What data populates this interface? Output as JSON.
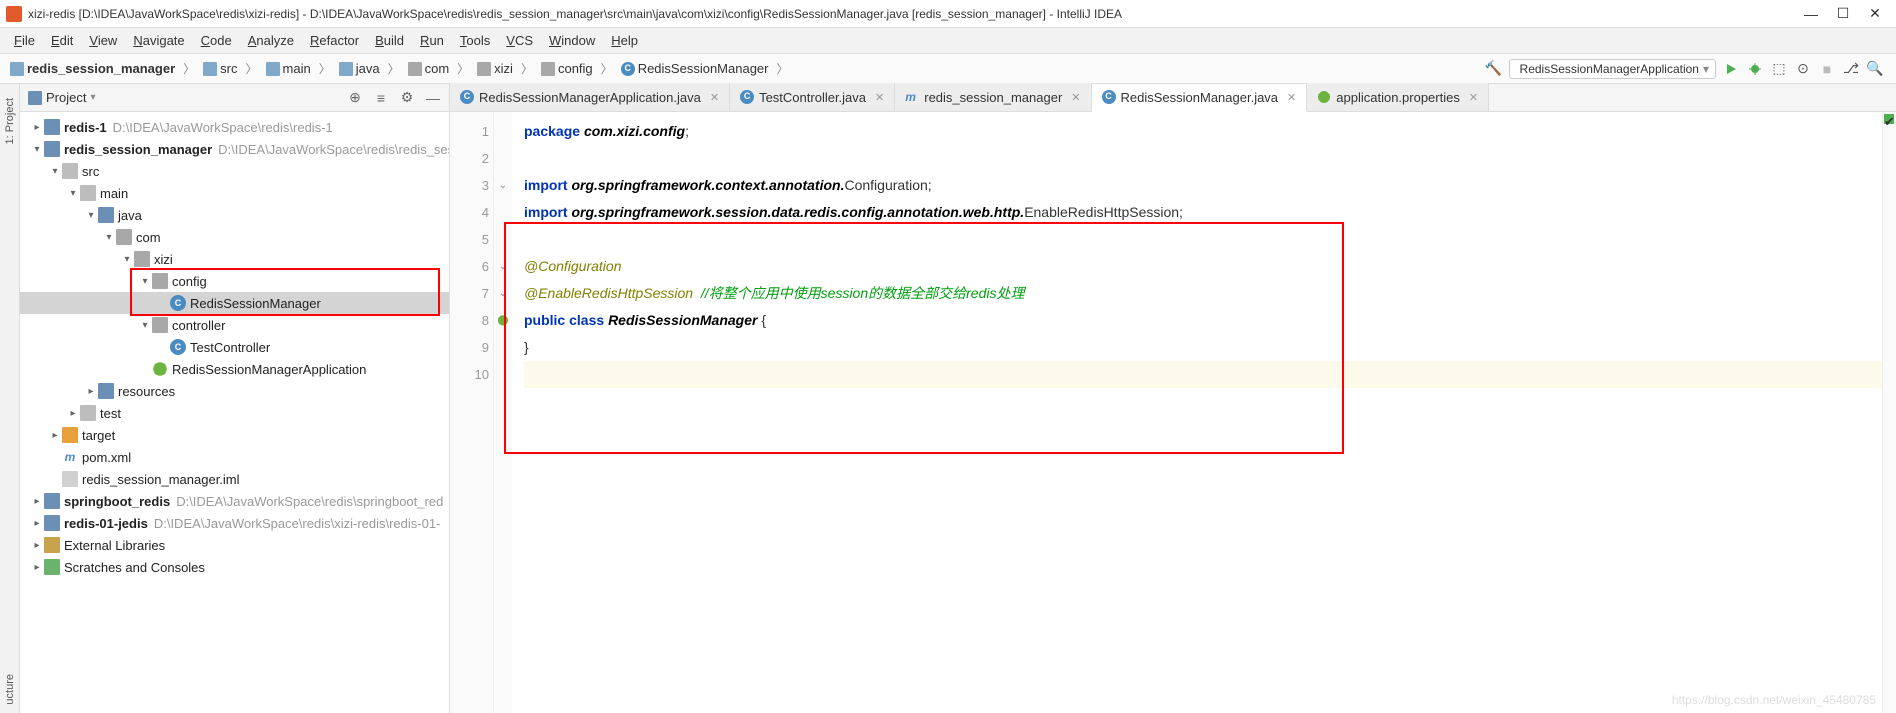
{
  "titlebar": {
    "title": "xizi-redis [D:\\IDEA\\JavaWorkSpace\\redis\\xizi-redis] - D:\\IDEA\\JavaWorkSpace\\redis\\redis_session_manager\\src\\main\\java\\com\\xizi\\config\\RedisSessionManager.java [redis_session_manager] - IntelliJ IDEA"
  },
  "menu": {
    "items": [
      "File",
      "Edit",
      "View",
      "Navigate",
      "Code",
      "Analyze",
      "Refactor",
      "Build",
      "Run",
      "Tools",
      "VCS",
      "Window",
      "Help"
    ]
  },
  "breadcrumb": {
    "items": [
      {
        "icon": "folder",
        "label": "redis_session_manager",
        "bold": true
      },
      {
        "icon": "folder",
        "label": "src"
      },
      {
        "icon": "folder",
        "label": "main"
      },
      {
        "icon": "folder",
        "label": "java"
      },
      {
        "icon": "pkg",
        "label": "com"
      },
      {
        "icon": "pkg",
        "label": "xizi"
      },
      {
        "icon": "pkg",
        "label": "config"
      },
      {
        "icon": "class",
        "label": "RedisSessionManager"
      }
    ]
  },
  "run_config": "RedisSessionManagerApplication",
  "project_panel": {
    "title": "Project"
  },
  "tree": [
    {
      "indent": 0,
      "twisty": ">",
      "icon": "mod",
      "label": "redis-1",
      "bold": true,
      "path": "D:\\IDEA\\JavaWorkSpace\\redis\\redis-1"
    },
    {
      "indent": 0,
      "twisty": "v",
      "icon": "mod",
      "label": "redis_session_manager",
      "bold": true,
      "path": "D:\\IDEA\\JavaWorkSpace\\redis\\redis_ses"
    },
    {
      "indent": 1,
      "twisty": "v",
      "icon": "fold",
      "label": "src"
    },
    {
      "indent": 2,
      "twisty": "v",
      "icon": "fold",
      "label": "main"
    },
    {
      "indent": 3,
      "twisty": "v",
      "icon": "srcfold",
      "label": "java"
    },
    {
      "indent": 4,
      "twisty": "v",
      "icon": "pkg",
      "label": "com"
    },
    {
      "indent": 5,
      "twisty": "v",
      "icon": "pkg",
      "label": "xizi"
    },
    {
      "indent": 6,
      "twisty": "v",
      "icon": "pkg",
      "label": "config",
      "red": true
    },
    {
      "indent": 7,
      "twisty": "",
      "icon": "class",
      "label": "RedisSessionManager",
      "selected": true,
      "red": true
    },
    {
      "indent": 6,
      "twisty": "v",
      "icon": "pkg",
      "label": "controller"
    },
    {
      "indent": 7,
      "twisty": "",
      "icon": "class",
      "label": "TestController"
    },
    {
      "indent": 6,
      "twisty": "",
      "icon": "spring",
      "label": "RedisSessionManagerApplication"
    },
    {
      "indent": 3,
      "twisty": ">",
      "icon": "srcfold",
      "label": "resources"
    },
    {
      "indent": 2,
      "twisty": ">",
      "icon": "fold",
      "label": "test"
    },
    {
      "indent": 1,
      "twisty": ">",
      "icon": "target",
      "label": "target"
    },
    {
      "indent": 1,
      "twisty": "",
      "icon": "maven",
      "label": "pom.xml"
    },
    {
      "indent": 1,
      "twisty": "",
      "icon": "file",
      "label": "redis_session_manager.iml"
    },
    {
      "indent": 0,
      "twisty": ">",
      "icon": "mod",
      "label": "springboot_redis",
      "bold": true,
      "path": "D:\\IDEA\\JavaWorkSpace\\redis\\springboot_red"
    },
    {
      "indent": 0,
      "twisty": ">",
      "icon": "mod",
      "label": "redis-01-jedis",
      "bold": true,
      "path": "D:\\IDEA\\JavaWorkSpace\\redis\\xizi-redis\\redis-01-"
    },
    {
      "indent": 0,
      "twisty": ">",
      "icon": "lib",
      "label": "External Libraries"
    },
    {
      "indent": 0,
      "twisty": ">",
      "icon": "scratch",
      "label": "Scratches and Consoles"
    }
  ],
  "tabs": [
    {
      "icon": "class",
      "label": "RedisSessionManagerApplication.java"
    },
    {
      "icon": "class",
      "label": "TestController.java"
    },
    {
      "icon": "maven",
      "label": "redis_session_manager"
    },
    {
      "icon": "class",
      "label": "RedisSessionManager.java",
      "active": true
    },
    {
      "icon": "spring",
      "label": "application.properties"
    }
  ],
  "code": {
    "lines": [
      {
        "n": 1,
        "html": "<span class='kw'>package</span> <span class='pkg'>com.xizi.config</span>;"
      },
      {
        "n": 2,
        "html": ""
      },
      {
        "n": 3,
        "html": "<span class='kw'>import</span> <span class='pkg'>org.springframework.context.annotation.</span>Configuration;"
      },
      {
        "n": 4,
        "html": "<span class='kw'>import</span> <span class='pkg'>org.springframework.session.data.redis.config.annotation.web.http.</span>EnableRedisHttpSession;"
      },
      {
        "n": 5,
        "html": ""
      },
      {
        "n": 6,
        "html": "<span class='ann'>@Configuration</span>"
      },
      {
        "n": 7,
        "html": "<span class='ann'>@EnableRedisHttpSession</span>  <span class='comment'>//将整个应用中使用session的数据全部交给redis处理</span>"
      },
      {
        "n": 8,
        "html": "<span class='kw'>public</span> <span class='kw'>class</span> <span class='cls'>RedisSessionManager</span> {"
      },
      {
        "n": 9,
        "html": "}"
      },
      {
        "n": 10,
        "html": "",
        "caret": true
      }
    ]
  },
  "left_strip": {
    "project": "1: Project",
    "structure": "ucture"
  },
  "watermark": "https://blog.csdn.net/weixin_45480785"
}
